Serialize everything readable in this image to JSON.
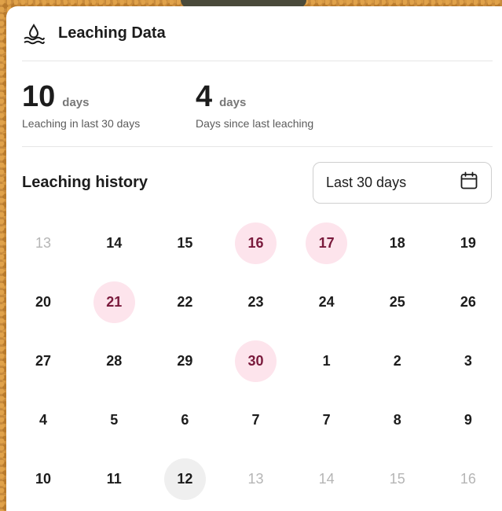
{
  "header": {
    "title": "Leaching Data",
    "icon": "water-drop-icon"
  },
  "stats": [
    {
      "value": "10",
      "unit": "days",
      "description": "Leaching in last 30 days"
    },
    {
      "value": "4",
      "unit": "days",
      "description": "Days since last leaching"
    }
  ],
  "history": {
    "label": "Leaching history",
    "range_select": {
      "value": "Last 30 days",
      "icon": "calendar-icon"
    }
  },
  "calendar": {
    "rows": [
      [
        {
          "d": "13",
          "state": "muted"
        },
        {
          "d": "14",
          "state": "normal"
        },
        {
          "d": "15",
          "state": "normal"
        },
        {
          "d": "16",
          "state": "leach"
        },
        {
          "d": "17",
          "state": "leach"
        },
        {
          "d": "18",
          "state": "normal"
        },
        {
          "d": "19",
          "state": "normal"
        }
      ],
      [
        {
          "d": "20",
          "state": "normal"
        },
        {
          "d": "21",
          "state": "leach"
        },
        {
          "d": "22",
          "state": "normal"
        },
        {
          "d": "23",
          "state": "normal"
        },
        {
          "d": "24",
          "state": "normal"
        },
        {
          "d": "25",
          "state": "normal"
        },
        {
          "d": "26",
          "state": "normal"
        }
      ],
      [
        {
          "d": "27",
          "state": "normal"
        },
        {
          "d": "28",
          "state": "normal"
        },
        {
          "d": "29",
          "state": "normal"
        },
        {
          "d": "30",
          "state": "leach"
        },
        {
          "d": "1",
          "state": "normal"
        },
        {
          "d": "2",
          "state": "normal"
        },
        {
          "d": "3",
          "state": "normal"
        }
      ],
      [
        {
          "d": "4",
          "state": "normal"
        },
        {
          "d": "5",
          "state": "normal"
        },
        {
          "d": "6",
          "state": "normal"
        },
        {
          "d": "7",
          "state": "normal"
        },
        {
          "d": "7",
          "state": "normal"
        },
        {
          "d": "8",
          "state": "normal"
        },
        {
          "d": "9",
          "state": "normal"
        }
      ],
      [
        {
          "d": "10",
          "state": "normal"
        },
        {
          "d": "11",
          "state": "normal"
        },
        {
          "d": "12",
          "state": "today"
        },
        {
          "d": "13",
          "state": "muted"
        },
        {
          "d": "14",
          "state": "muted"
        },
        {
          "d": "15",
          "state": "muted"
        },
        {
          "d": "16",
          "state": "muted"
        }
      ]
    ]
  },
  "colors": {
    "leach_bg": "#fde4ec",
    "leach_text": "#7a1a3c",
    "today_bg": "#efefef",
    "muted_text": "#b5b5b5"
  }
}
